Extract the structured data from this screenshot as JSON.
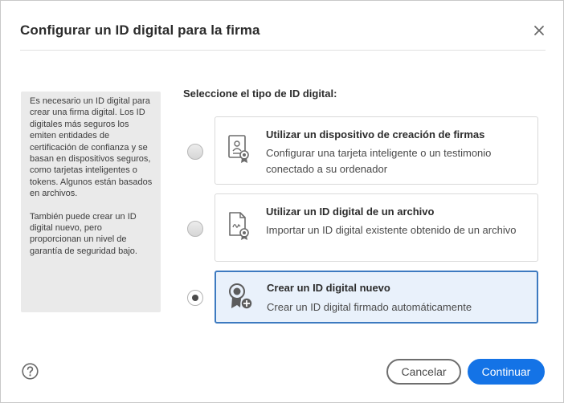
{
  "dialog": {
    "title": "Configurar un ID digital para la firma",
    "close_icon": "close-icon"
  },
  "info_panel": {
    "paragraph_1": "Es necesario un ID digital para crear una firma digital. Los ID digitales más seguros los emiten entidades de certificación de confianza y se basan en dispositivos seguros, como tarjetas inteligentes o tokens. Algunos están basados en archivos.",
    "paragraph_2": "También puede crear un ID digital nuevo, pero proporcionan un nivel de garantía de seguridad bajo."
  },
  "section_label": "Seleccione el tipo de ID digital:",
  "options": [
    {
      "title": "Utilizar un dispositivo de creación de firmas",
      "description": "Configurar una tarjeta inteligente o un testimonio conectado a su ordenador",
      "icon": "signature-device-icon",
      "selected": false
    },
    {
      "title": "Utilizar un ID digital de un archivo",
      "description": "Importar un ID digital existente obtenido de un archivo",
      "icon": "digital-id-file-icon",
      "selected": false
    },
    {
      "title": "Crear un ID digital nuevo",
      "description": "Crear un ID digital firmado automáticamente",
      "icon": "new-digital-id-icon",
      "selected": true
    }
  ],
  "footer": {
    "help_icon": "help-icon",
    "cancel_label": "Cancelar",
    "continue_label": "Continuar"
  },
  "colors": {
    "accent": "#1473e6",
    "selected_border": "#3d7ac0",
    "selected_bg": "#e9f1fb",
    "info_bg": "#eaeaea"
  }
}
